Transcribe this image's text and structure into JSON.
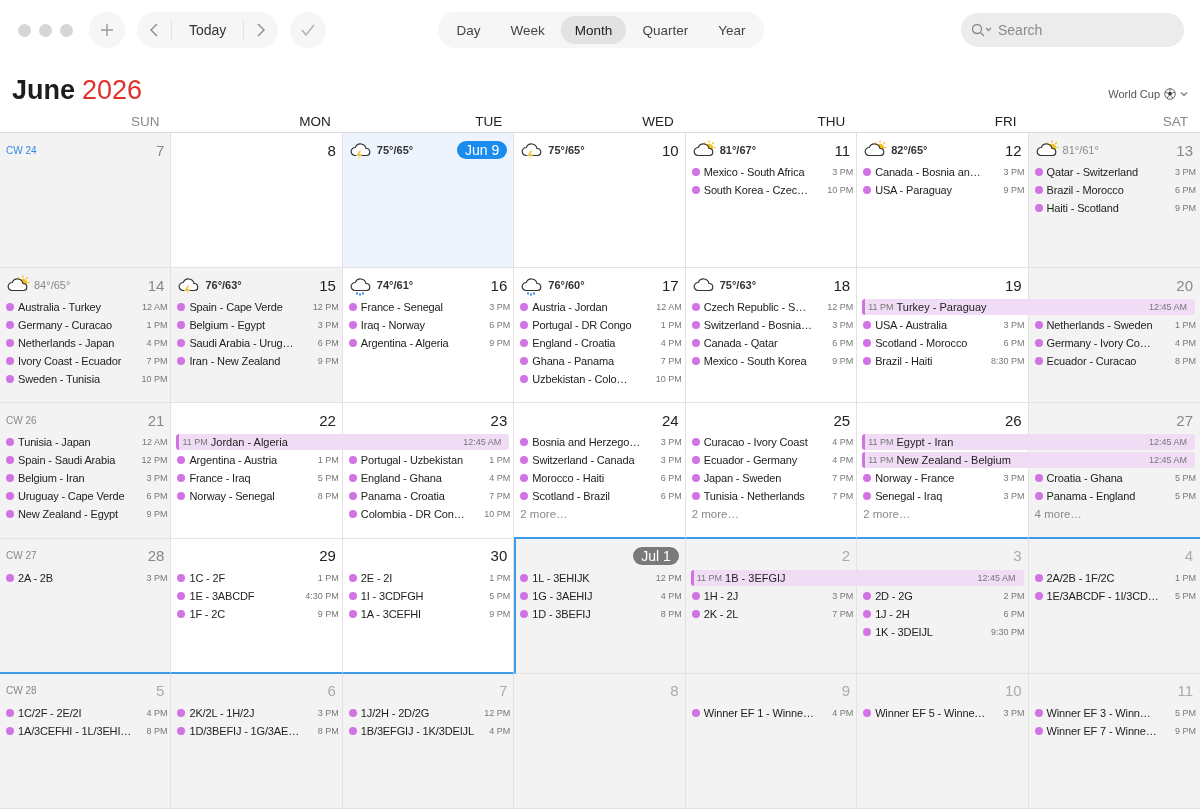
{
  "toolbar": {
    "today_button": "Today",
    "views": [
      {
        "label": "Day",
        "selected": false
      },
      {
        "label": "Week",
        "selected": false
      },
      {
        "label": "Month",
        "selected": true
      },
      {
        "label": "Quarter",
        "selected": false
      },
      {
        "label": "Year",
        "selected": false
      }
    ],
    "search": {
      "placeholder": "Search"
    }
  },
  "heading": {
    "month": "June",
    "year": "2026",
    "calendar": "World Cup"
  },
  "weekdays": [
    {
      "label": "SUN",
      "weekend": true
    },
    {
      "label": "MON",
      "weekend": false
    },
    {
      "label": "TUE",
      "weekend": false
    },
    {
      "label": "WED",
      "weekend": false
    },
    {
      "label": "THU",
      "weekend": false
    },
    {
      "label": "FRI",
      "weekend": false
    },
    {
      "label": "SAT",
      "weekend": true
    }
  ],
  "weeks": [
    {
      "week_label": "CW 24",
      "current": true,
      "days": [
        {
          "date": "7",
          "in_month": true,
          "shaded": true,
          "today": false,
          "month_start": false
        },
        {
          "date": "8",
          "in_month": true,
          "shaded": false,
          "today": false,
          "month_start": false
        },
        {
          "date": "Jun 9",
          "in_month": true,
          "shaded": false,
          "today": true,
          "month_start": false,
          "weather": {
            "kind": "storm",
            "temp": "75°/65°"
          }
        },
        {
          "date": "10",
          "in_month": true,
          "shaded": false,
          "today": false,
          "month_start": false,
          "weather": {
            "kind": "storm",
            "temp": "75°/65°"
          }
        },
        {
          "date": "11",
          "in_month": true,
          "shaded": false,
          "today": false,
          "month_start": false,
          "weather": {
            "kind": "partly_sunny",
            "temp": "81°/67°"
          },
          "events": [
            {
              "title": "Mexico - South Africa",
              "time": "3 PM"
            },
            {
              "title": "South Korea - Czec…",
              "time": "10 PM"
            }
          ]
        },
        {
          "date": "12",
          "in_month": true,
          "shaded": false,
          "today": false,
          "month_start": false,
          "weather": {
            "kind": "partly_sunny",
            "temp": "82°/65°"
          },
          "events": [
            {
              "title": "Canada - Bosnia an…",
              "time": "3 PM"
            },
            {
              "title": "USA - Paraguay",
              "time": "9 PM"
            }
          ]
        },
        {
          "date": "13",
          "in_month": true,
          "shaded": true,
          "today": false,
          "month_start": false,
          "weather": {
            "kind": "partly_sunny",
            "temp": "81°/61°"
          },
          "events": [
            {
              "title": "Qatar - Switzerland",
              "time": "3 PM"
            },
            {
              "title": "Brazil - Morocco",
              "time": "6 PM"
            },
            {
              "title": "Haiti - Scotland",
              "time": "9 PM"
            }
          ]
        }
      ]
    },
    {
      "days": [
        {
          "date": "14",
          "in_month": true,
          "shaded": true,
          "today": false,
          "month_start": false,
          "weather": {
            "kind": "partly_sunny",
            "temp": "84°/65°"
          },
          "events": [
            {
              "title": "Australia - Turkey",
              "time": "12 AM"
            },
            {
              "title": "Germany - Curacao",
              "time": "1 PM"
            },
            {
              "title": "Netherlands - Japan",
              "time": "4 PM"
            },
            {
              "title": "Ivory Coast - Ecuador",
              "time": "7 PM"
            },
            {
              "title": "Sweden - Tunisia",
              "time": "10 PM"
            }
          ]
        },
        {
          "date": "15",
          "in_month": true,
          "shaded": true,
          "today": false,
          "month_start": false,
          "weather": {
            "kind": "storm",
            "temp": "76°/63°"
          },
          "events": [
            {
              "title": "Spain - Cape Verde",
              "time": "12 PM"
            },
            {
              "title": "Belgium - Egypt",
              "time": "3 PM"
            },
            {
              "title": "Saudi Arabia - Urug…",
              "time": "6 PM"
            },
            {
              "title": "Iran - New Zealand",
              "time": "9 PM"
            }
          ]
        },
        {
          "date": "16",
          "in_month": true,
          "shaded": false,
          "today": false,
          "month_start": false,
          "weather": {
            "kind": "rain",
            "temp": "74°/61°"
          },
          "events": [
            {
              "title": "France - Senegal",
              "time": "3 PM"
            },
            {
              "title": "Iraq - Norway",
              "time": "6 PM"
            },
            {
              "title": "Argentina - Algeria",
              "time": "9 PM"
            }
          ]
        },
        {
          "date": "17",
          "in_month": true,
          "shaded": false,
          "today": false,
          "month_start": false,
          "weather": {
            "kind": "rain",
            "temp": "76°/60°"
          },
          "events": [
            {
              "title": "Austria - Jordan",
              "time": "12 AM"
            },
            {
              "title": "Portugal - DR Congo",
              "time": "1 PM"
            },
            {
              "title": "England - Croatia",
              "time": "4 PM"
            },
            {
              "title": "Ghana - Panama",
              "time": "7 PM"
            },
            {
              "title": "Uzbekistan - Colo…",
              "time": "10 PM"
            }
          ]
        },
        {
          "date": "18",
          "in_month": true,
          "shaded": false,
          "today": false,
          "month_start": false,
          "weather": {
            "kind": "cloudy",
            "temp": "75°/63°"
          },
          "events": [
            {
              "title": "Czech Republic - S…",
              "time": "12 PM"
            },
            {
              "title": "Switzerland - Bosnia…",
              "time": "3 PM"
            },
            {
              "title": "Canada - Qatar",
              "time": "6 PM"
            },
            {
              "title": "Mexico - South Korea",
              "time": "9 PM"
            }
          ]
        },
        {
          "date": "19",
          "in_month": true,
          "shaded": false,
          "today": false,
          "month_start": false,
          "overnight": [
            {
              "start": "11 PM",
              "title": "Turkey - Paraguay",
              "end": "12:45 AM"
            }
          ],
          "events": [
            {
              "title": "USA - Australia",
              "time": "3 PM"
            },
            {
              "title": "Scotland - Morocco",
              "time": "6 PM"
            },
            {
              "title": "Brazil - Haiti",
              "time": "8:30 PM"
            }
          ]
        },
        {
          "date": "20",
          "in_month": true,
          "shaded": true,
          "today": false,
          "month_start": false,
          "events": [
            {
              "title": "Netherlands - Sweden",
              "time": "1 PM"
            },
            {
              "title": "Germany - Ivory Co…",
              "time": "4 PM"
            },
            {
              "title": "Ecuador - Curacao",
              "time": "8 PM"
            }
          ]
        }
      ]
    },
    {
      "week_label": "CW 26",
      "current": false,
      "days": [
        {
          "date": "21",
          "in_month": true,
          "shaded": true,
          "today": false,
          "month_start": false,
          "events": [
            {
              "title": "Tunisia - Japan",
              "time": "12 AM"
            },
            {
              "title": "Spain - Saudi Arabia",
              "time": "12 PM"
            },
            {
              "title": "Belgium - Iran",
              "time": "3 PM"
            },
            {
              "title": "Uruguay - Cape Verde",
              "time": "6 PM"
            },
            {
              "title": "New Zealand - Egypt",
              "time": "9 PM"
            }
          ]
        },
        {
          "date": "22",
          "in_month": true,
          "shaded": false,
          "today": false,
          "month_start": false,
          "overnight": [
            {
              "start": "11 PM",
              "title": "Jordan - Algeria",
              "end": "12:45 AM"
            }
          ],
          "events": [
            {
              "title": "Argentina - Austria",
              "time": "1 PM"
            },
            {
              "title": "France - Iraq",
              "time": "5 PM"
            },
            {
              "title": "Norway - Senegal",
              "time": "8 PM"
            }
          ]
        },
        {
          "date": "23",
          "in_month": true,
          "shaded": false,
          "today": false,
          "month_start": false,
          "events": [
            {
              "title": "Portugal - Uzbekistan",
              "time": "1 PM"
            },
            {
              "title": "England - Ghana",
              "time": "4 PM"
            },
            {
              "title": "Panama - Croatia",
              "time": "7 PM"
            },
            {
              "title": "Colombia - DR Con…",
              "time": "10 PM"
            }
          ]
        },
        {
          "date": "24",
          "in_month": true,
          "shaded": false,
          "today": false,
          "month_start": false,
          "more": "2 more…",
          "events": [
            {
              "title": "Bosnia and Herzego…",
              "time": "3 PM"
            },
            {
              "title": "Switzerland - Canada",
              "time": "3 PM"
            },
            {
              "title": "Morocco - Haiti",
              "time": "6 PM"
            },
            {
              "title": "Scotland - Brazil",
              "time": "6 PM"
            }
          ]
        },
        {
          "date": "25",
          "in_month": true,
          "shaded": false,
          "today": false,
          "month_start": false,
          "more": "2 more…",
          "events": [
            {
              "title": "Curacao - Ivory Coast",
              "time": "4 PM"
            },
            {
              "title": "Ecuador - Germany",
              "time": "4 PM"
            },
            {
              "title": "Japan - Sweden",
              "time": "7 PM"
            },
            {
              "title": "Tunisia - Netherlands",
              "time": "7 PM"
            }
          ]
        },
        {
          "date": "26",
          "in_month": true,
          "shaded": false,
          "today": false,
          "month_start": false,
          "more": "2 more…",
          "overnight": [
            {
              "start": "11 PM",
              "title": "Egypt - Iran",
              "end": "12:45 AM"
            },
            {
              "start": "11 PM",
              "title": "New Zealand - Belgium",
              "end": "12:45 AM"
            }
          ],
          "events": [
            {
              "title": "Norway - France",
              "time": "3 PM"
            },
            {
              "title": "Senegal - Iraq",
              "time": "3 PM"
            }
          ]
        },
        {
          "date": "27",
          "in_month": true,
          "shaded": true,
          "today": false,
          "month_start": false,
          "more": "4 more…",
          "events": [
            {
              "title": "Croatia - Ghana",
              "time": "5 PM"
            },
            {
              "title": "Panama - England",
              "time": "5 PM"
            }
          ]
        }
      ]
    },
    {
      "week_label": "CW 27",
      "current": false,
      "days": [
        {
          "date": "28",
          "in_month": true,
          "shaded": true,
          "today": false,
          "month_start": false,
          "events": [
            {
              "title": "2A - 2B",
              "time": "3 PM"
            }
          ]
        },
        {
          "date": "29",
          "in_month": true,
          "shaded": false,
          "today": false,
          "month_start": false,
          "events": [
            {
              "title": "1C - 2F",
              "time": "1 PM"
            },
            {
              "title": "1E - 3ABCDF",
              "time": "4:30 PM"
            },
            {
              "title": "1F - 2C",
              "time": "9 PM"
            }
          ]
        },
        {
          "date": "30",
          "in_month": true,
          "shaded": false,
          "today": false,
          "month_start": false,
          "events": [
            {
              "title": "2E - 2I",
              "time": "1 PM"
            },
            {
              "title": "1I - 3CDFGH",
              "time": "5 PM"
            },
            {
              "title": "1A - 3CEFHI",
              "time": "9 PM"
            }
          ]
        },
        {
          "date": "Jul 1",
          "in_month": false,
          "shaded": true,
          "today": false,
          "month_start": true,
          "events": [
            {
              "title": "1L - 3EHIJK",
              "time": "12 PM"
            },
            {
              "title": "1G - 3AEHIJ",
              "time": "4 PM"
            },
            {
              "title": "1D - 3BEFIJ",
              "time": "8 PM"
            }
          ]
        },
        {
          "date": "2",
          "in_month": false,
          "shaded": true,
          "today": false,
          "month_start": false,
          "overnight": [
            {
              "start": "11 PM",
              "title": "1B - 3EFGIJ",
              "end": "12:45 AM"
            }
          ],
          "events": [
            {
              "title": "1H - 2J",
              "time": "3 PM"
            },
            {
              "title": "2K - 2L",
              "time": "7 PM"
            }
          ]
        },
        {
          "date": "3",
          "in_month": false,
          "shaded": true,
          "today": false,
          "month_start": false,
          "events": [
            {
              "title": "2D - 2G",
              "time": "2 PM"
            },
            {
              "title": "1J - 2H",
              "time": "6 PM"
            },
            {
              "title": "1K - 3DEIJL",
              "time": "9:30 PM"
            }
          ]
        },
        {
          "date": "4",
          "in_month": false,
          "shaded": true,
          "today": false,
          "month_start": false,
          "events": [
            {
              "title": "2A/2B - 1F/2C",
              "time": "1 PM"
            },
            {
              "title": "1E/3ABCDF - 1I/3CD…",
              "time": "5 PM"
            }
          ]
        }
      ]
    },
    {
      "week_label": "CW 28",
      "current": false,
      "days": [
        {
          "date": "5",
          "in_month": false,
          "shaded": true,
          "today": false,
          "month_start": false,
          "events": [
            {
              "title": "1C/2F - 2E/2I",
              "time": "4 PM"
            },
            {
              "title": "1A/3CEFHI - 1L/3EHI…",
              "time": "8 PM"
            }
          ]
        },
        {
          "date": "6",
          "in_month": false,
          "shaded": true,
          "today": false,
          "month_start": false,
          "events": [
            {
              "title": "2K/2L - 1H/2J",
              "time": "3 PM"
            },
            {
              "title": "1D/3BEFIJ - 1G/3AE…",
              "time": "8 PM"
            }
          ]
        },
        {
          "date": "7",
          "in_month": false,
          "shaded": true,
          "today": false,
          "month_start": false,
          "events": [
            {
              "title": "1J/2H - 2D/2G",
              "time": "12 PM"
            },
            {
              "title": "1B/3EFGIJ - 1K/3DEIJL",
              "time": "4 PM"
            }
          ]
        },
        {
          "date": "8",
          "in_month": false,
          "shaded": true,
          "today": false,
          "month_start": false
        },
        {
          "date": "9",
          "in_month": false,
          "shaded": true,
          "today": false,
          "month_start": false,
          "events": [
            {
              "title": "Winner EF 1 - Winne…",
              "time": "4 PM"
            }
          ]
        },
        {
          "date": "10",
          "in_month": false,
          "shaded": true,
          "today": false,
          "month_start": false,
          "events": [
            {
              "title": "Winner EF 5 - Winne…",
              "time": "3 PM"
            }
          ]
        },
        {
          "date": "11",
          "in_month": false,
          "shaded": true,
          "today": false,
          "month_start": false,
          "events": [
            {
              "title": "Winner EF 3 - Winn…",
              "time": "5 PM"
            },
            {
              "title": "Winner EF 7 - Winne…",
              "time": "9 PM"
            }
          ]
        }
      ]
    }
  ]
}
